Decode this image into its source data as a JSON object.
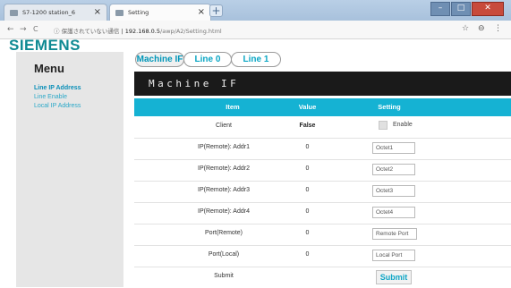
{
  "browser": {
    "tabs": [
      {
        "label": "S7-1200 station_6"
      },
      {
        "label": "Setting"
      }
    ],
    "new_tab_symbol": "+",
    "window_controls": {
      "minimize": "–",
      "maximize": "□",
      "close": "✕"
    },
    "nav": {
      "back": "←",
      "forward": "→",
      "reload": "C"
    },
    "address": {
      "security_warning": "ⓘ 保護されていない通信",
      "host": "192.168.0.5",
      "path": "/awp/A2/Setting.html"
    },
    "star_icon": "☆",
    "profile_icon": "⊖",
    "menu_icon": "⋮"
  },
  "logo": "SIEMENS",
  "sidebar": {
    "title": "Menu",
    "items": [
      {
        "label": "Line IP Address",
        "active": true
      },
      {
        "label": "Line Enable",
        "active": false
      },
      {
        "label": "Local IP Address",
        "active": false
      }
    ]
  },
  "top_buttons": [
    {
      "label": "Machine IF",
      "active": true
    },
    {
      "label": "Line 0",
      "active": false
    },
    {
      "label": "Line 1",
      "active": false
    }
  ],
  "page_header": "Machine IF",
  "table": {
    "headers": {
      "item": "Item",
      "value": "Value",
      "setting": "Setting"
    },
    "client": {
      "item": "Client",
      "value": "False",
      "checkbox_label": "Enable"
    },
    "rows": [
      {
        "item": "IP(Remote): Addr1",
        "value": "0",
        "placeholder": "Octet1"
      },
      {
        "item": "IP(Remote): Addr2",
        "value": "0",
        "placeholder": "Octet2"
      },
      {
        "item": "IP(Remote): Addr3",
        "value": "0",
        "placeholder": "Octet3"
      },
      {
        "item": "IP(Remote): Addr4",
        "value": "0",
        "placeholder": "Octet4"
      },
      {
        "item": "Port(Remote)",
        "value": "0",
        "placeholder": "Remote Port"
      },
      {
        "item": "Port(Local)",
        "value": "0",
        "placeholder": "Local Port"
      }
    ],
    "submit": {
      "item": "Submit",
      "button_label": "Submit"
    }
  },
  "colors": {
    "accent": "#15b2d3",
    "logo": "#0f8a93",
    "header_bar": "#1a1a1a",
    "sidebar_bg": "#e6e6e6"
  }
}
